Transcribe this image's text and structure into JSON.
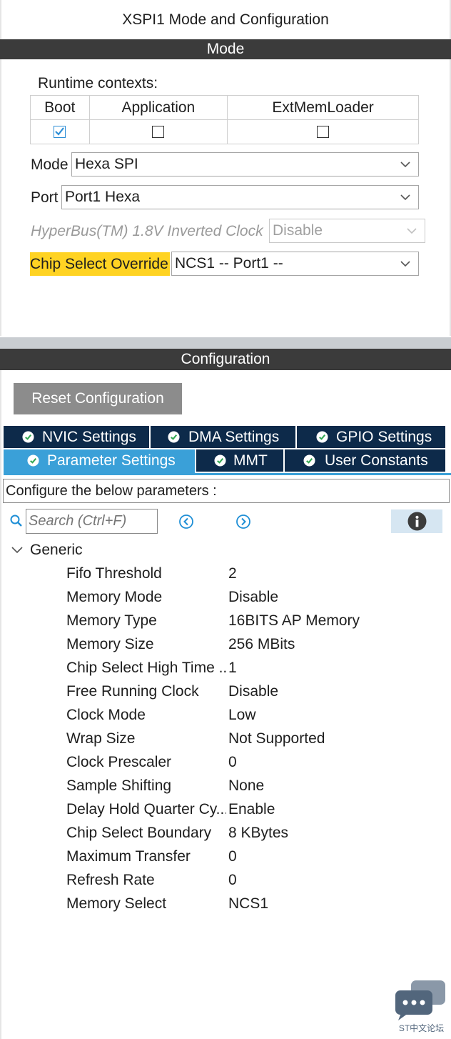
{
  "window_title": "XSPI1 Mode and Configuration",
  "mode_section": {
    "header": "Mode",
    "runtime_label": "Runtime contexts:",
    "contexts": [
      {
        "label": "Boot",
        "checked": true
      },
      {
        "label": "Application",
        "checked": false
      },
      {
        "label": "ExtMemLoader",
        "checked": false
      }
    ],
    "mode": {
      "label": "Mode",
      "value": "Hexa SPI"
    },
    "port": {
      "label": "Port",
      "value": "Port1 Hexa"
    },
    "hyperbus": {
      "label": "HyperBus(TM) 1.8V Inverted Clock",
      "value": "Disable"
    },
    "chip_select": {
      "label": "Chip Select Override",
      "value": "NCS1 -- Port1 --"
    }
  },
  "config_section": {
    "header": "Configuration",
    "reset_button": "Reset Configuration",
    "tabs_row1": [
      "NVIC Settings",
      "DMA Settings",
      "GPIO Settings"
    ],
    "tabs_row2": [
      "Parameter Settings",
      "MMT",
      "User Constants"
    ],
    "info_text": "Configure the below parameters :",
    "search_placeholder": "Search (Ctrl+F)",
    "group_label": "Generic",
    "params": [
      {
        "name": "Fifo Threshold",
        "value": "2"
      },
      {
        "name": "Memory Mode",
        "value": "Disable"
      },
      {
        "name": "Memory Type",
        "value": "16BITS AP Memory"
      },
      {
        "name": "Memory Size",
        "value": "256 MBits"
      },
      {
        "name": "Chip Select High Time ..",
        "value": "1"
      },
      {
        "name": "Free Running Clock",
        "value": "Disable"
      },
      {
        "name": "Clock Mode",
        "value": "Low"
      },
      {
        "name": "Wrap Size",
        "value": "Not Supported"
      },
      {
        "name": "Clock Prescaler",
        "value": "0"
      },
      {
        "name": "Sample Shifting",
        "value": "None"
      },
      {
        "name": "Delay Hold Quarter Cy...",
        "value": "Enable"
      },
      {
        "name": "Chip Select Boundary",
        "value": "8 KBytes"
      },
      {
        "name": "Maximum Transfer",
        "value": "0"
      },
      {
        "name": "Refresh Rate",
        "value": "0"
      },
      {
        "name": "Memory Select",
        "value": "NCS1"
      }
    ]
  },
  "watermark": "ST中文论坛",
  "colors": {
    "header_bar": "#3b3b3b",
    "tab_dark": "#0d2a4a",
    "tab_active": "#3aa0d8",
    "highlight": "#ffd323",
    "check_blue": "#2d8ed6",
    "ok_green": "#34a853"
  }
}
